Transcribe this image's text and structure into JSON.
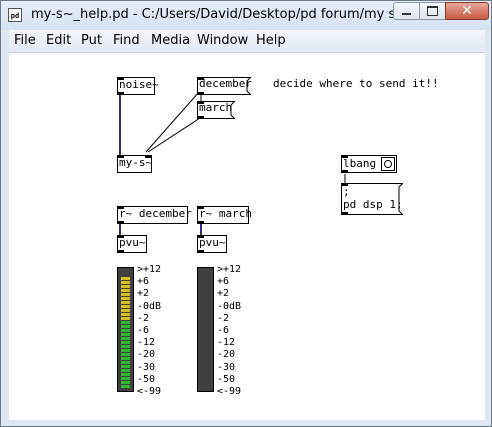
{
  "window": {
    "title": "my-s~_help.pd  - C:/Users/David/Desktop/pd forum/my send",
    "icon_label": "pd",
    "controls": [
      "minimize",
      "maximize",
      "close"
    ],
    "close_glyph": "✕"
  },
  "menu": [
    "File",
    "Edit",
    "Put",
    "Find",
    "Media",
    "Window",
    "Help"
  ],
  "patch": {
    "objects": {
      "noise": "noise~",
      "my_s": "my-s~",
      "r_december": "r~ december",
      "r_march": "r~ march",
      "pvu_left": "pvu~",
      "pvu_right": "pvu~",
      "lbang": "lbang"
    },
    "messages": {
      "december": "december",
      "march": "march",
      "semicolon": ";",
      "dsp": "pd dsp 1;"
    },
    "comment": "decide where to send it!!",
    "meter_scale": [
      ">+12",
      "+6",
      "+2",
      "-0dB",
      "-2",
      "-6",
      "-12",
      "-20",
      "-30",
      "-50",
      "<-99"
    ],
    "colors": {
      "connection_signal": "#2b2f7f",
      "meter_bg": "#404040",
      "meter_green": "#2db82d",
      "meter_yellow": "#d8c020"
    },
    "meter_left_level_segments": 28,
    "meter_right_level_segments": 0
  }
}
